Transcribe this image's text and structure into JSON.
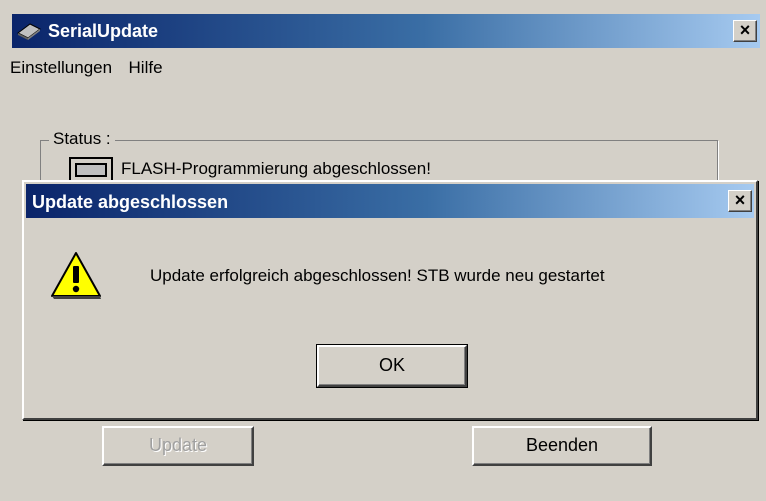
{
  "main_window": {
    "title": "SerialUpdate",
    "close_label": "×",
    "menu": [
      "Einstellungen",
      "Hilfe"
    ],
    "status_group_label": "Status :",
    "status_text": "FLASH-Programmierung abgeschlossen!",
    "update_button": "Update",
    "quit_button": "Beenden"
  },
  "dialog": {
    "title": "Update abgeschlossen",
    "close_label": "×",
    "message": "Update erfolgreich abgeschlossen! STB wurde neu gestartet",
    "ok_button": "OK",
    "icon": "warning-icon"
  },
  "colors": {
    "titlebar_start": "#0a246a",
    "titlebar_end": "#a6caf0",
    "window_bg": "#d4d0c8",
    "warning_yellow": "#ffff00"
  }
}
